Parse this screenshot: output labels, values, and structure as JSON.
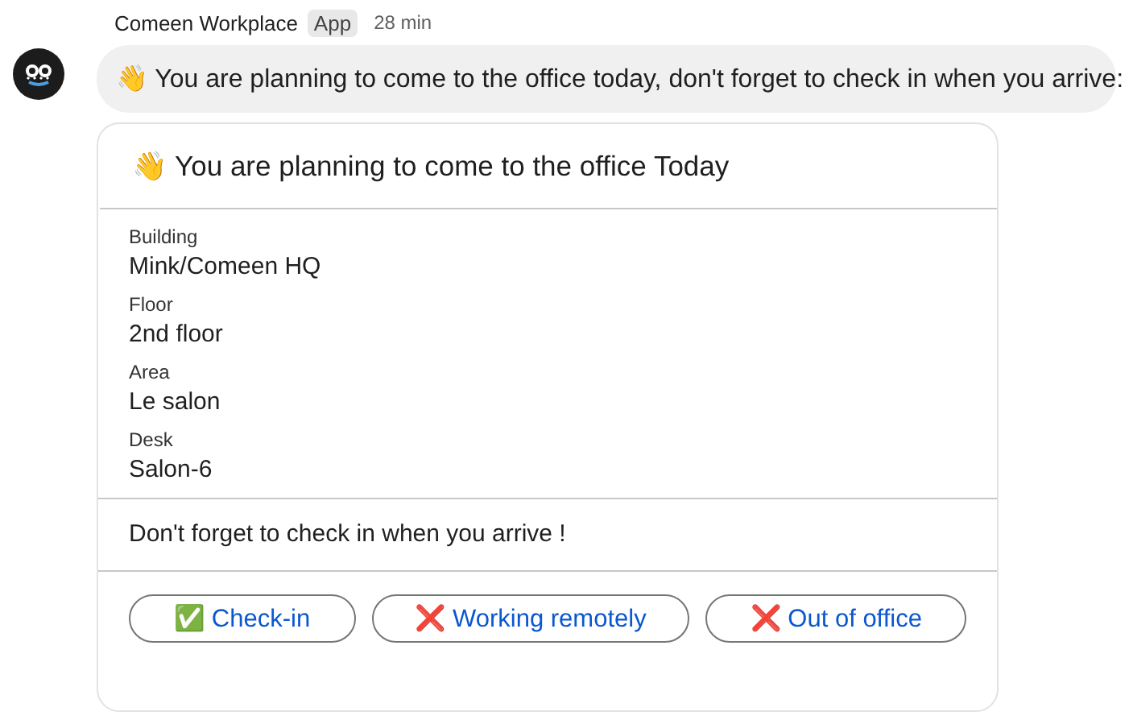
{
  "message": {
    "sender": "Comeen Workplace",
    "badge": "App",
    "time": "28 min",
    "text": "👋 You are planning to come to the office today, don't forget to check in when you arrive:"
  },
  "card": {
    "title": "👋 You are planning to come to the office Today",
    "fields": [
      {
        "label": "Building",
        "value": "Mink/Comeen HQ"
      },
      {
        "label": "Floor",
        "value": "2nd floor"
      },
      {
        "label": "Area",
        "value": "Le salon"
      },
      {
        "label": "Desk",
        "value": "Salon-6"
      }
    ],
    "note": "Don't forget to check in when you arrive !",
    "buttons": [
      "✅ Check-in",
      "❌ Working remotely",
      "❌ Out of office"
    ]
  }
}
